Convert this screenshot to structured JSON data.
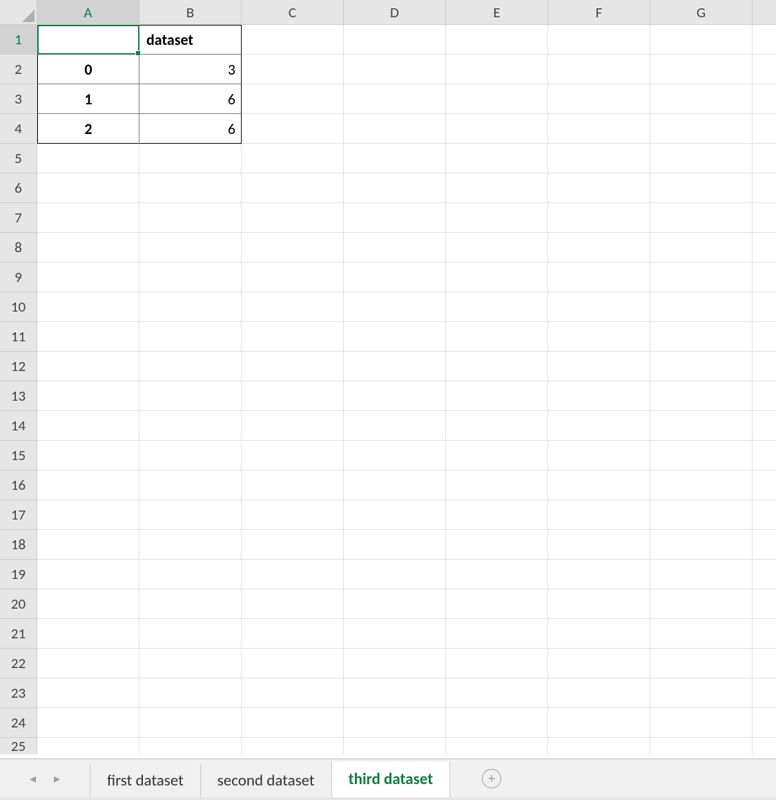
{
  "columns": [
    "A",
    "B",
    "C",
    "D",
    "E",
    "F",
    "G"
  ],
  "activeColumn": "A",
  "rows": [
    1,
    2,
    3,
    4,
    5,
    6,
    7,
    8,
    9,
    10,
    11,
    12,
    13,
    14,
    15,
    16,
    17,
    18,
    19,
    20,
    21,
    22,
    23,
    24,
    25
  ],
  "activeRow": 1,
  "activeCell": "A1",
  "table": {
    "header": {
      "A": "",
      "B": "dataset"
    },
    "data": [
      {
        "A": "0",
        "B": "3"
      },
      {
        "A": "1",
        "B": "6"
      },
      {
        "A": "2",
        "B": "6"
      }
    ]
  },
  "tabs": [
    {
      "label": "first dataset",
      "active": false
    },
    {
      "label": "second dataset",
      "active": false
    },
    {
      "label": "third dataset",
      "active": true
    }
  ],
  "newSheetGlyph": "+",
  "nav": {
    "prev": "◂",
    "next": "▸"
  }
}
